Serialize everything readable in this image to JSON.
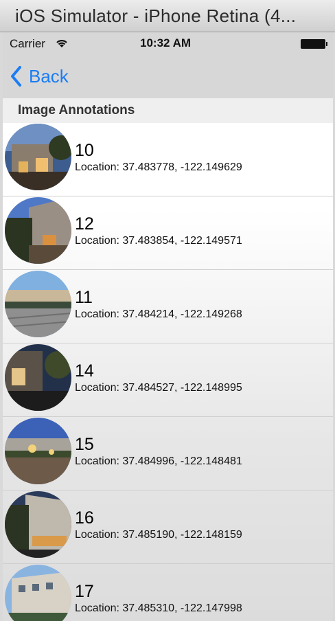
{
  "window": {
    "title": "iOS Simulator - iPhone Retina (4..."
  },
  "statusbar": {
    "carrier": "Carrier",
    "time": "10:32 AM"
  },
  "navbar": {
    "back_label": "Back"
  },
  "section": {
    "header": "Image Annotations"
  },
  "annotations": [
    {
      "id": "10",
      "location": "Location: 37.483778, -122.149629"
    },
    {
      "id": "12",
      "location": "Location: 37.483854, -122.149571"
    },
    {
      "id": "11",
      "location": "Location: 37.484214, -122.149268"
    },
    {
      "id": "14",
      "location": "Location: 37.484527, -122.148995"
    },
    {
      "id": "15",
      "location": "Location: 37.484996, -122.148481"
    },
    {
      "id": "16",
      "location": "Location: 37.485190, -122.148159"
    },
    {
      "id": "17",
      "location": "Location: 37.485310, -122.147998"
    }
  ]
}
